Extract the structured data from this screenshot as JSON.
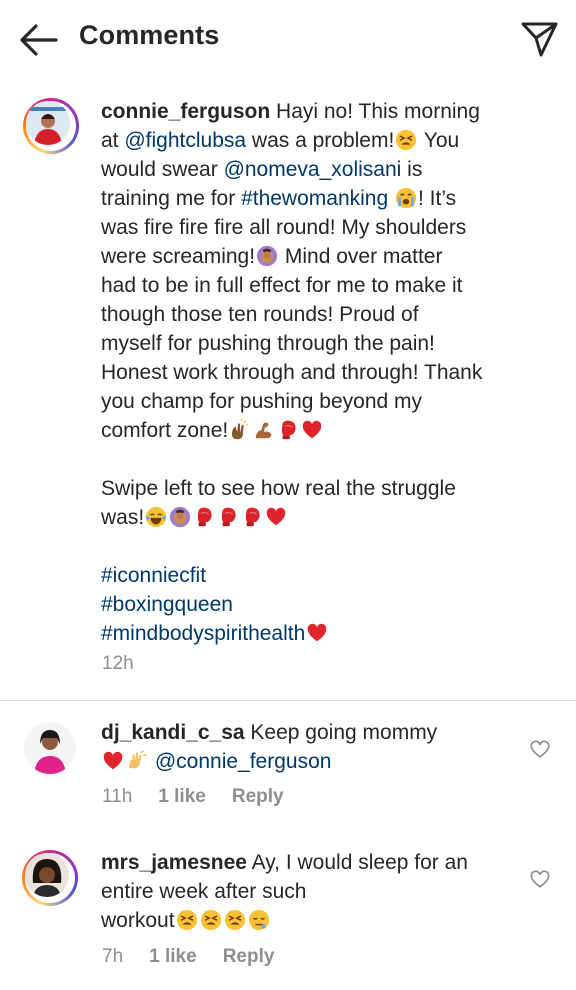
{
  "header": {
    "title": "Comments"
  },
  "caption": {
    "username": "connie_ferguson",
    "l1": " Hayi no! This morning",
    "l2a": "at ",
    "l2m": "@fightclubsa",
    "l2b": " was a problem!",
    "l2c": " You",
    "l3a": "would swear ",
    "l3m": "@nomeva_xolisani",
    "l3b": " is",
    "l4a": "training me for ",
    "l4t": "#thewomanking",
    "l4b": "! It’s",
    "l5": "was fire fire fire all round! My shoulders",
    "l6a": "were screaming!",
    "l6b": " Mind over matter",
    "l7": "had to be in full effect for me to make it",
    "l8": "though those ten rounds! Proud of",
    "l9": "myself for pushing through the pain!",
    "l10": "Honest work through and through! Thank",
    "l11": "you champ for pushing beyond my",
    "l12": "comfort zone!",
    "l13": "Swipe left to see how real the struggle",
    "l14": "was!",
    "tag1": "#iconniecfit",
    "tag2": "#boxingqueen",
    "tag3": "#mindbodyspirithealth",
    "time": "12h"
  },
  "comments": [
    {
      "username": "dj_kandi_c_sa",
      "l1": " Keep going mommy",
      "mention": "@connie_ferguson",
      "time": "11h",
      "likes": "1 like",
      "reply": "Reply"
    },
    {
      "username": "mrs_jamesnee",
      "l1": " Ay, I would sleep for an",
      "l2": "entire week after such",
      "l3": "workout",
      "time": "7h",
      "likes": "1 like",
      "reply": "Reply"
    }
  ],
  "icons": {
    "back": "arrow-left-icon",
    "send": "send-paper-plane-icon",
    "like": "heart-outline-icon"
  },
  "colors": {
    "link": "#00376b",
    "meta": "#8e8e8e",
    "divider": "#dbdbdb"
  }
}
